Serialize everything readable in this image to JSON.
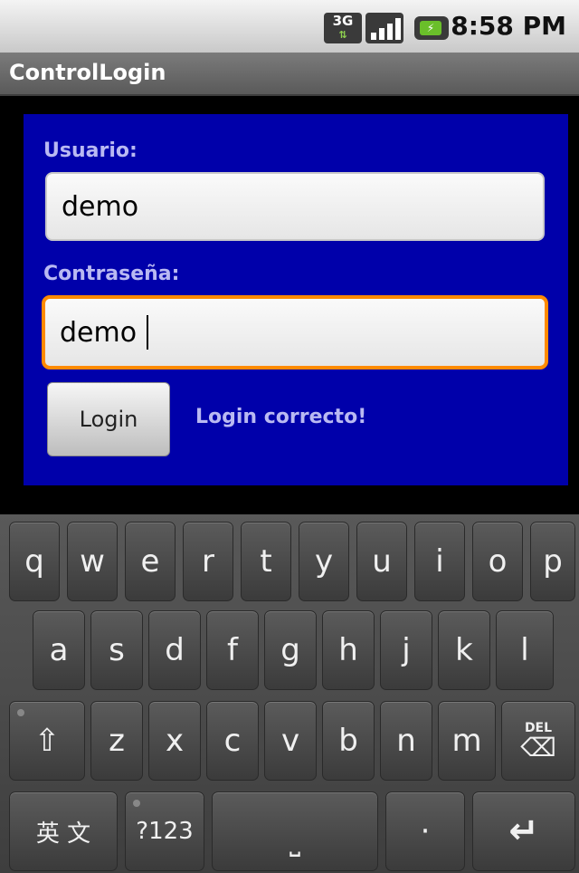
{
  "status_bar": {
    "network": "3G",
    "time": "8:58 PM"
  },
  "app": {
    "title": "ControlLogin"
  },
  "form": {
    "user_label": "Usuario:",
    "user_value": "demo",
    "password_label": "Contraseña:",
    "password_value": "demo",
    "login_button": "Login",
    "status_message": "Login correcto!"
  },
  "keyboard": {
    "row1": [
      "q",
      "w",
      "e",
      "r",
      "t",
      "y",
      "u",
      "i",
      "o",
      "p"
    ],
    "row2": [
      "a",
      "s",
      "d",
      "f",
      "g",
      "h",
      "j",
      "k",
      "l"
    ],
    "row3": [
      "z",
      "x",
      "c",
      "v",
      "b",
      "n",
      "m"
    ],
    "lang_key": "英 文",
    "symbols_key": "?123",
    "period_key": "·",
    "del_label": "DEL"
  },
  "colors": {
    "panel": "#0000aa",
    "focus": "#ff8a00",
    "label": "#b9b9f2"
  }
}
